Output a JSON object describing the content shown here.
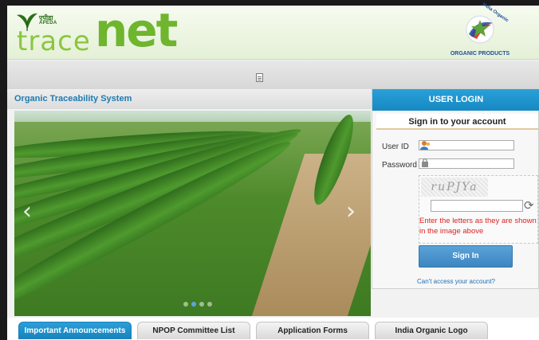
{
  "header": {
    "logo_hindi": "एपीडा",
    "logo_apeda": "APEDA",
    "logo_trace": "trace",
    "logo_net": "net",
    "organic_arc": "India Organic",
    "organic_text": "ORGANIC PRODUCTS"
  },
  "slider": {
    "title": "Organic Traceability System",
    "prev_arrow": "‹",
    "next_arrow": "›"
  },
  "login": {
    "heading": "USER LOGIN",
    "subheading": "Sign in to your account",
    "user_id_label": "User ID",
    "password_label": "Password",
    "captcha_text": "ruPJYa",
    "captcha_message": "Enter the letters as they are shown in the image above",
    "sign_in_label": "Sign In",
    "cant_access_label": "Can't access your account?",
    "refresh_glyph": "⟳"
  },
  "tabs": [
    {
      "label": "Important Announcements",
      "active": true
    },
    {
      "label": "NPOP Committee List",
      "active": false
    },
    {
      "label": "Application Forms",
      "active": false
    },
    {
      "label": "India Organic Logo",
      "active": false
    }
  ],
  "colors": {
    "accent_blue": "#1e88c7",
    "brand_green": "#6fb52e",
    "error_red": "#dd2222"
  }
}
